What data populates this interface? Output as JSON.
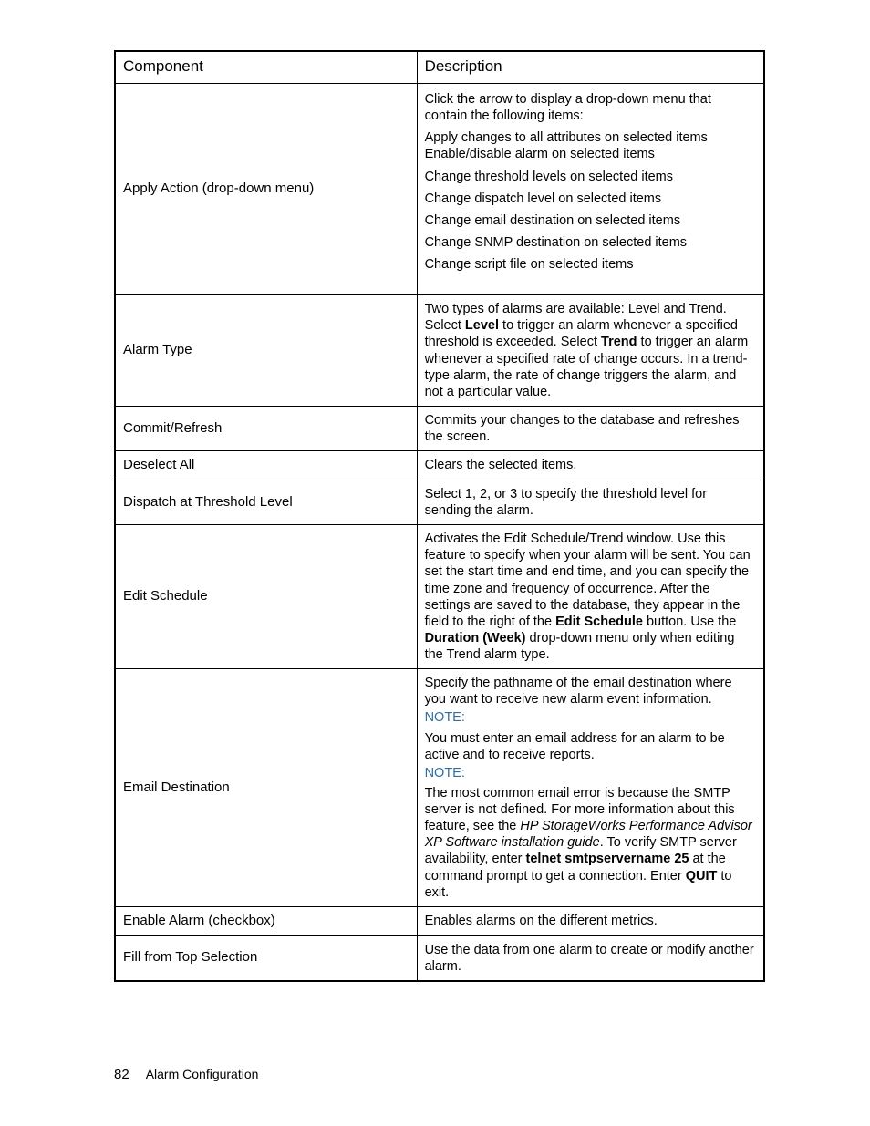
{
  "headers": {
    "col1": "Component",
    "col2": "Description"
  },
  "rows": {
    "applyAction": {
      "component": "Apply Action (drop-down menu)",
      "intro": "Click the arrow to display a drop-down menu that contain the following items:",
      "items": [
        "Apply changes to all attributes on selected items",
        "Enable/disable alarm on selected items",
        "Change threshold levels on selected items",
        "Change dispatch level on selected items",
        "Change email destination on selected items",
        "Change SNMP destination on selected items",
        "Change script file on selected items"
      ]
    },
    "alarmType": {
      "component": "Alarm Type",
      "pre": "Two types of alarms are available: Level and Trend. Select ",
      "b1": "Level",
      "mid1": " to trigger an alarm whenever a specified threshold is exceeded. Select ",
      "b2": "Trend",
      "post": " to trigger an alarm whenever a specified rate of change occurs. In a trend-type alarm, the rate of change triggers the alarm, and not a particular value."
    },
    "commitRefresh": {
      "component": "Commit/Refresh",
      "desc": "Commits your changes to the database and refreshes the screen."
    },
    "deselectAll": {
      "component": "Deselect All",
      "desc": "Clears the selected items."
    },
    "dispatch": {
      "component": "Dispatch at Threshold Level",
      "desc": "Select 1, 2, or 3 to specify the threshold level for sending the alarm."
    },
    "editSchedule": {
      "component": "Edit Schedule",
      "pre": "Activates the Edit Schedule/Trend window. Use this feature to specify when your alarm will be sent. You can set the start time and end time, and you can specify the time zone and frequency of occurrence. After the settings are saved to the database, they appear in the field to the right of the ",
      "b1": "Edit Schedule",
      "mid": " button. Use the ",
      "b2": "Duration (Week)",
      "post": " drop-down menu only when editing the Trend alarm type."
    },
    "emailDest": {
      "component": "Email Destination",
      "p1": "Specify the pathname of the email destination where you want to receive new alarm event information.",
      "note": "NOTE:",
      "p2": "You must enter an email address for an alarm to be active and to receive reports.",
      "p3a": "The most common email error is because the SMTP server is not defined. For more information about this feature, see the ",
      "p3i": "HP StorageWorks Performance Advisor XP Software installation guide",
      "p3b": ". To verify SMTP server availability, enter ",
      "p3bold1": "telnet smtpservername 25",
      "p3c": " at the command prompt to get a connection. Enter ",
      "p3bold2": "QUIT",
      "p3d": " to exit."
    },
    "enableAlarm": {
      "component": "Enable Alarm (checkbox)",
      "desc": "Enables alarms on the different metrics."
    },
    "fillTop": {
      "component": "Fill from Top Selection",
      "desc": "Use the data from one alarm to create or modify another alarm."
    }
  },
  "footer": {
    "pageNum": "82",
    "title": "Alarm Configuration"
  }
}
